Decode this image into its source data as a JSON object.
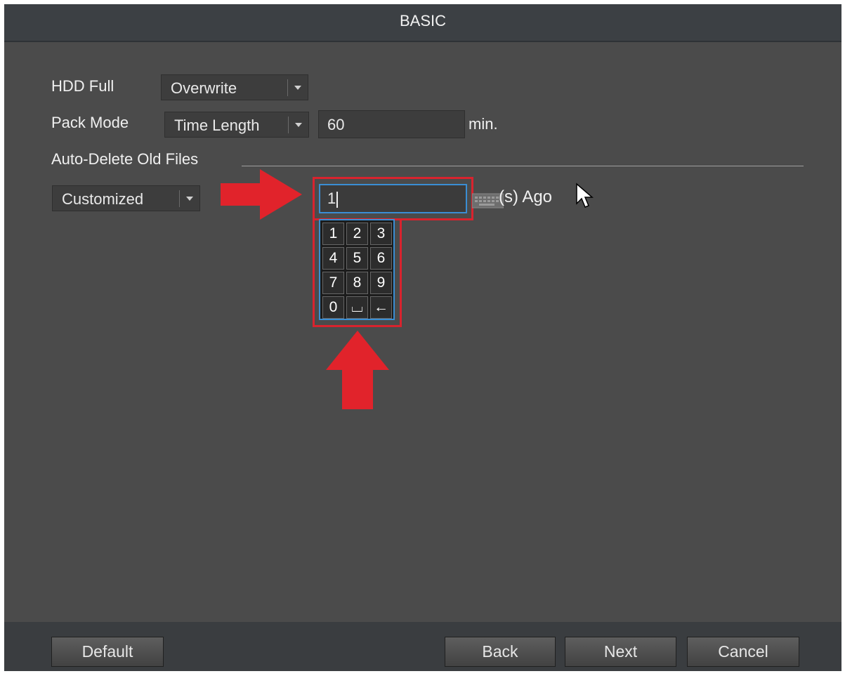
{
  "window": {
    "title": "BASIC"
  },
  "settings": {
    "hdd_full": {
      "label": "HDD Full",
      "value": "Overwrite"
    },
    "pack_mode": {
      "label": "Pack Mode",
      "value": "Time Length",
      "length_value": "60",
      "length_unit": "min."
    },
    "auto_delete": {
      "label": "Auto-Delete Old Files",
      "mode_value": "Customized",
      "days_value": "1",
      "suffix": "(s) Ago"
    }
  },
  "keypad": {
    "keys": [
      "1",
      "2",
      "3",
      "4",
      "5",
      "6",
      "7",
      "8",
      "9",
      "0",
      "⌴",
      "←"
    ]
  },
  "footer": {
    "default_label": "Default",
    "back_label": "Back",
    "next_label": "Next",
    "cancel_label": "Cancel"
  },
  "colors": {
    "background": "#4b4b4b",
    "title_bar": "#3c4044",
    "highlight_red": "#d9232e",
    "focus_blue": "#3a8ed4"
  },
  "icons": [
    "dropdown-arrow-icon",
    "keyboard-icon",
    "cursor-icon",
    "arrow-right-annotation",
    "arrow-up-annotation"
  ]
}
